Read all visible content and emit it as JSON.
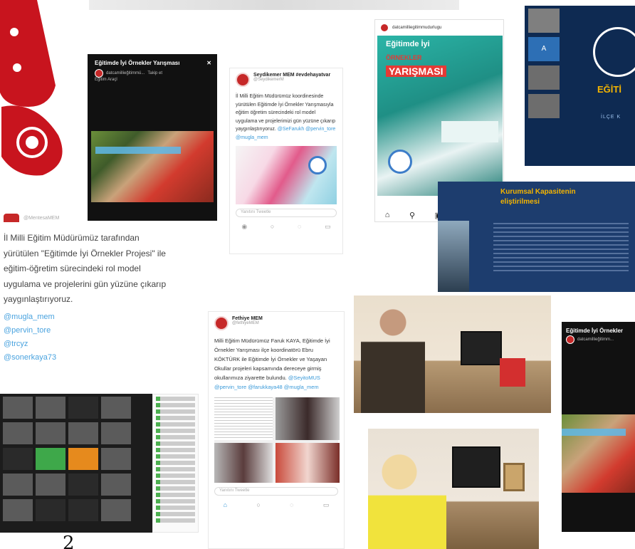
{
  "cards": {
    "dark_video": {
      "title": "Eğitimde İyi Örnekler Yarışması",
      "account": "datcamillieğitimmü...",
      "follow": "Takip et",
      "location": "Eğitim Araçl"
    },
    "tweet_datca": {
      "name": "Seydikemer MEM #evdehayatvar",
      "handle": "@SeydikemerM",
      "text": "İl Milli Eğitim Müdürümüz koordinesinde yürütülen Eğitimde İyi Örnekler Yarışmasıyla eğitim öğretim sürecindeki rol model uygulama ve projelerimizi gün yüzüne çıkarıp yaygınlaştırıyoruz.",
      "links": "@SeFarukh @pervin_tore @mugla_mem",
      "reply_placeholder": "Yanıtını Tweetle"
    },
    "instagram": {
      "account": "datcamilliegitimmudurlugu",
      "poster_line1": "Eğitimde İyi",
      "poster_line2": "ÖRNEKLER",
      "poster_line3": "YARIŞMASI"
    },
    "meeting": {
      "tile_letter": "A",
      "brand": "EĞİTİ",
      "district": "İLÇE K"
    },
    "kurumsal": {
      "title_line1": "Kurumsal Kapasitenin",
      "title_line2": "eliştirilmesi"
    },
    "big_tweet": {
      "handle": "@MentesaMEM",
      "text": "İl Milli Eğitim Müdürümüz tarafından yürütülen \"Eğitimde İyi Örnekler Projesi\" ile eğitim-öğretim sürecindeki rol model uygulama ve projelerini gün yüzüne çıkarıp yaygınlaştırıyoruz.",
      "links": [
        "@mugla_mem",
        "@pervin_tore",
        "@trcyz",
        "@sonerkaya73"
      ]
    },
    "tweet_fethiye": {
      "name": "Fethiye MEM",
      "handle": "@fethiyeMEM",
      "text": "Milli Eğitim Müdürümüz Faruk KAYA, Eğitimde İyi Örnekler Yarışması ilçe koordinatörü Ebru KÖKTÜRK ile Eğitimde İyi Örnekler ve Yaşayan Okullar projeleri kapsamında dereceye girmiş okullarımıza ziyarette bulundu.",
      "links": "@SeyitoMUS @pervin_tore @farukkaya48 @mugla_mem",
      "reply_placeholder": "Yanıtını Tweetle"
    },
    "dark_video_right": {
      "title": "Eğitimde İyi Örnekler",
      "account": "datcamillieğitimm..."
    }
  },
  "page_number": "2",
  "colors": {
    "accent_red": "#c62828",
    "twitter_link": "#3a9ad9",
    "navy": "#0e2a52",
    "gold": "#f4b400"
  }
}
